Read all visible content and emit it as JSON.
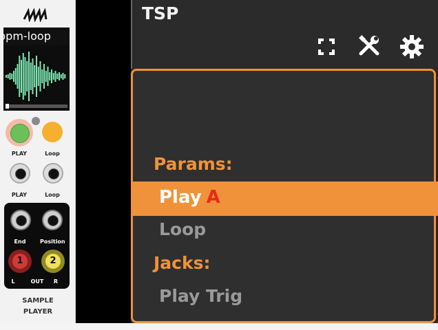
{
  "module": {
    "sample_name": "bpm-loop",
    "labels": {
      "play": "PLAY",
      "loop": "Loop",
      "play_jack": "PLAY",
      "loop_jack": "Loop",
      "end": "End",
      "position": "Position",
      "out_left": "L",
      "out": "OUT",
      "out_right": "R"
    },
    "outputs": [
      "1",
      "2"
    ],
    "title_line1": "SAMPLE",
    "title_line2": "PLAYER",
    "colors": {
      "waveform": "#7ee8b4",
      "play_knob": "#6dbf5a",
      "loop_knob": "#f6b030",
      "out1": "#d23a3a",
      "out2": "#f1e15a"
    }
  },
  "header": {
    "title": "TSP",
    "icons": [
      "fullscreen-icon",
      "tools-icon",
      "gear-icon"
    ]
  },
  "menu": {
    "sections": [
      {
        "label": "Params:",
        "items": [
          "Play",
          "Loop"
        ]
      },
      {
        "label": "Jacks:",
        "items": [
          "Play Trig"
        ]
      }
    ],
    "selected": {
      "label": "Play",
      "tag": "A"
    },
    "accent_color": "#f0923a"
  }
}
